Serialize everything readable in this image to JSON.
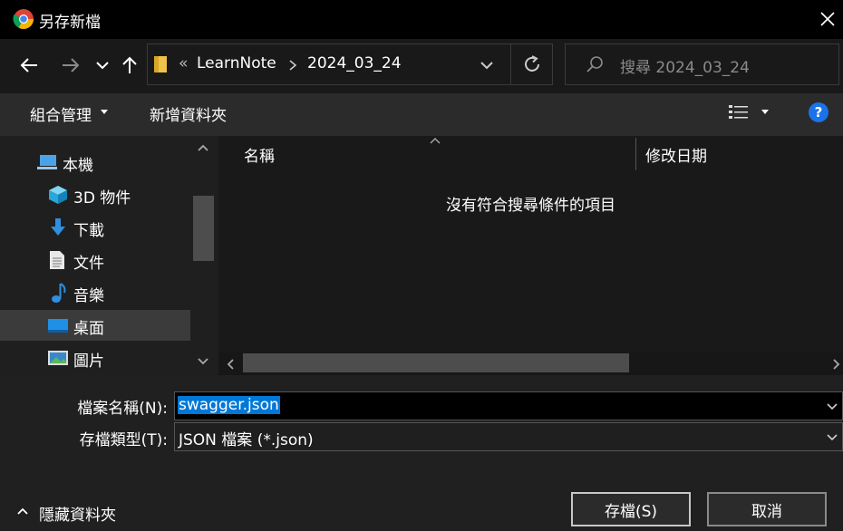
{
  "window": {
    "title": "另存新檔"
  },
  "address": {
    "overflow": "«",
    "crumbs": [
      "LearnNote",
      "2024_03_24"
    ]
  },
  "search": {
    "placeholder": "搜尋 2024_03_24"
  },
  "toolbar": {
    "organize": "組合管理",
    "new_folder": "新增資料夾",
    "help": "?"
  },
  "tree": {
    "items": [
      {
        "label": "本機",
        "icon": "computer-icon"
      },
      {
        "label": "3D 物件",
        "icon": "3d-objects-icon"
      },
      {
        "label": "下載",
        "icon": "download-icon"
      },
      {
        "label": "文件",
        "icon": "documents-icon"
      },
      {
        "label": "音樂",
        "icon": "music-icon"
      },
      {
        "label": "桌面",
        "icon": "desktop-icon",
        "selected": true
      },
      {
        "label": "圖片",
        "icon": "pictures-icon"
      }
    ]
  },
  "columns": {
    "name": "名稱",
    "modified": "修改日期"
  },
  "empty_message": "沒有符合搜尋條件的項目",
  "form": {
    "filename_label": "檔案名稱(N):",
    "filename_value": "swagger.json",
    "filetype_label": "存檔類型(T):",
    "filetype_value": "JSON 檔案 (*.json)"
  },
  "footer": {
    "hide_folders": "隱藏資料夾",
    "save": "存檔(S)",
    "cancel": "取消"
  },
  "colors": {
    "accent": "#0078d7",
    "folder": "#f0c24a",
    "help": "#1a73e8"
  }
}
